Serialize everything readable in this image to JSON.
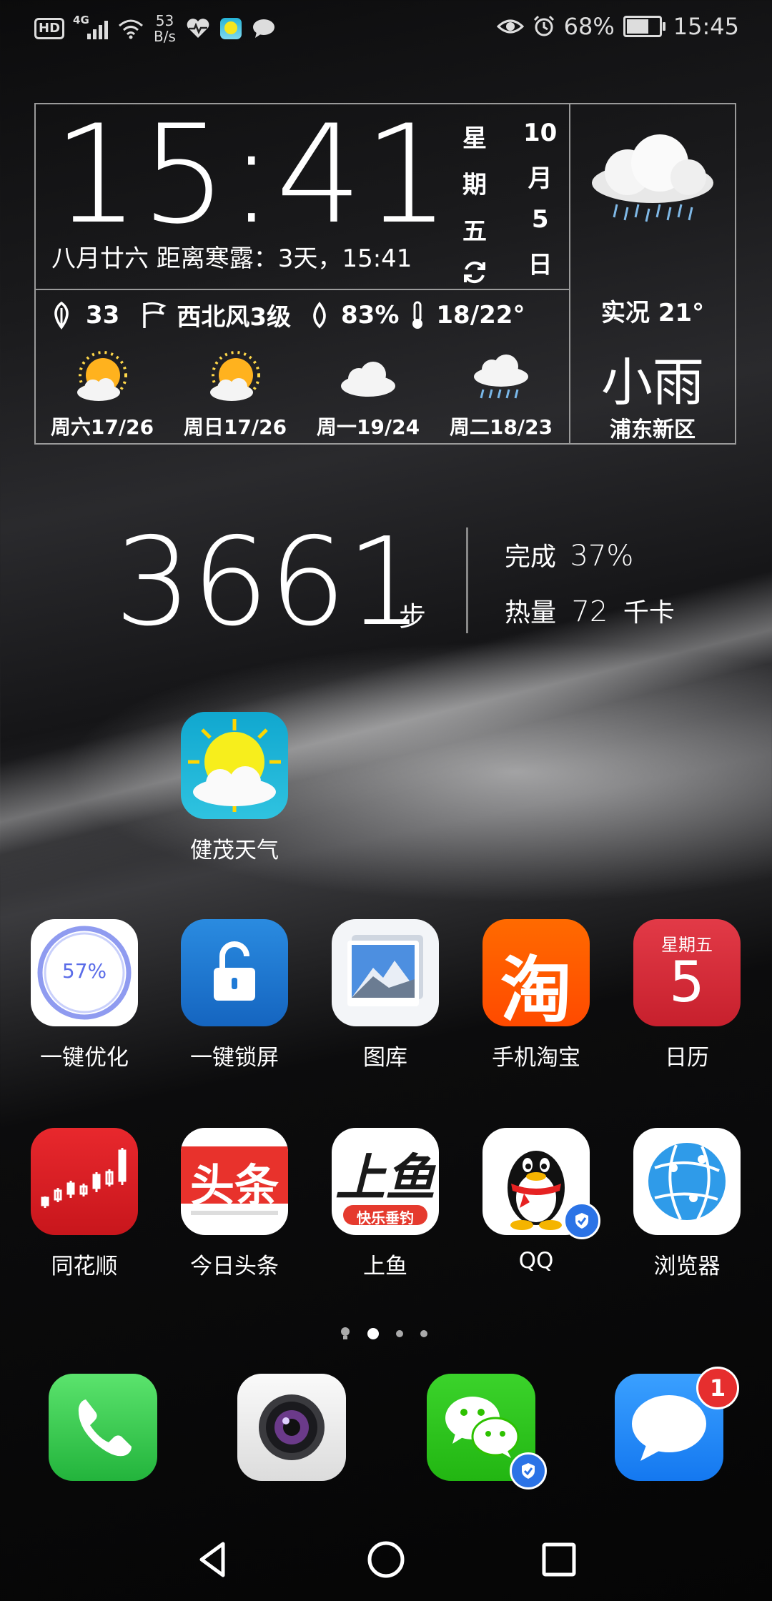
{
  "status_bar": {
    "hd_label": "HD",
    "network": "4G",
    "speed_value": "53",
    "speed_unit": "B/s",
    "battery_percent": "68%",
    "battery_level": 0.68,
    "time": "15:45"
  },
  "weather_widget": {
    "time": "15:41",
    "lunar_line": "八月廿六 距离寒露：3天，15:41",
    "weekday_chars": [
      "星",
      "期",
      "五"
    ],
    "date_chars": [
      "10",
      "月",
      "5",
      "日"
    ],
    "aqi": "33",
    "wind": "西北风3级",
    "humidity": "83%",
    "temp_range": "18/22°",
    "forecast": [
      {
        "label": "周六17/26",
        "icon": "sunny-cloud-icon"
      },
      {
        "label": "周日17/26",
        "icon": "sunny-cloud-icon"
      },
      {
        "label": "周一19/24",
        "icon": "cloud-icon"
      },
      {
        "label": "周二18/23",
        "icon": "rain-cloud-icon"
      }
    ],
    "current": "实况 21°",
    "condition": "小雨",
    "location": "浦东新区"
  },
  "steps_widget": {
    "count": "3661",
    "unit": "步",
    "completion_label": "完成",
    "completion_value": "37%",
    "calories_label": "热量",
    "calories_value": "72",
    "calories_unit": "千卡"
  },
  "apps": {
    "weather_app": {
      "label": "健茂天气"
    },
    "row1": [
      {
        "label": "一键优化",
        "icon_text": "57%"
      },
      {
        "label": "一键锁屏"
      },
      {
        "label": "图库"
      },
      {
        "label": "手机淘宝",
        "icon_text": "淘"
      },
      {
        "label": "日历",
        "icon_text_top": "星期五",
        "icon_text_main": "5"
      }
    ],
    "row2": [
      {
        "label": "同花顺"
      },
      {
        "label": "今日头条",
        "icon_text": "头条"
      },
      {
        "label": "上鱼",
        "icon_text": "上鱼",
        "icon_subtext": "快乐垂钓"
      },
      {
        "label": "QQ"
      },
      {
        "label": "浏览器"
      }
    ]
  },
  "dock": {
    "messages_badge": "1"
  },
  "colors": {
    "calendar_red": "#d9303e",
    "taobao_orange": "#ff5a00",
    "lock_blue": "#1f7ad6",
    "wechat_green": "#2dc100",
    "phone_green": "#34c759",
    "message_blue": "#1e88ff"
  }
}
